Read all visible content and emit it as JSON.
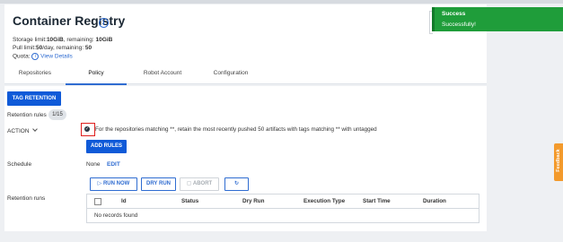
{
  "header": {
    "title": "Container Registry",
    "storage": {
      "label": "Storage limit:",
      "limit": "10GiB",
      "sep": ", remaining:",
      "remaining": "10GiB"
    },
    "pull": {
      "label": "Pull limit:",
      "limit": "50",
      "sep": "/day, remaining:",
      "remaining": "50"
    },
    "quota": {
      "label": "Quota:",
      "link": "View Details"
    }
  },
  "tabs": [
    {
      "label": "Repositories"
    },
    {
      "label": "Policy"
    },
    {
      "label": "Robot Account"
    },
    {
      "label": "Configuration"
    }
  ],
  "active_tab": "Policy",
  "policy": {
    "tag_retention_button": "TAG RETENTION",
    "retention_rules_label": "Retention rules",
    "retention_rules_count": "1/15",
    "action_label": "ACTION",
    "rule_text": "For the repositories matching **, retain the most recently pushed 50 artifacts with tags matching ** with untagged",
    "add_rules_button": "ADD RULES",
    "schedule_label": "Schedule",
    "schedule_value": "None",
    "schedule_edit": "EDIT",
    "retention_runs_label": "Retention runs",
    "run_now_button": "RUN NOW",
    "dry_run_button": "DRY RUN",
    "abort_button": "ABORT",
    "runs_table": {
      "columns": [
        "Id",
        "Status",
        "Dry Run",
        "Execution Type",
        "Start Time",
        "Duration"
      ],
      "empty_message": "No records found"
    }
  },
  "toast": {
    "title": "Success",
    "message": "Successfully!"
  },
  "feedback_tab": "Feedback",
  "colors": {
    "accent": "#0f5ad8",
    "success": "#1f9d3a",
    "feedback": "#f39a2c",
    "highlight": "#e0201f"
  }
}
